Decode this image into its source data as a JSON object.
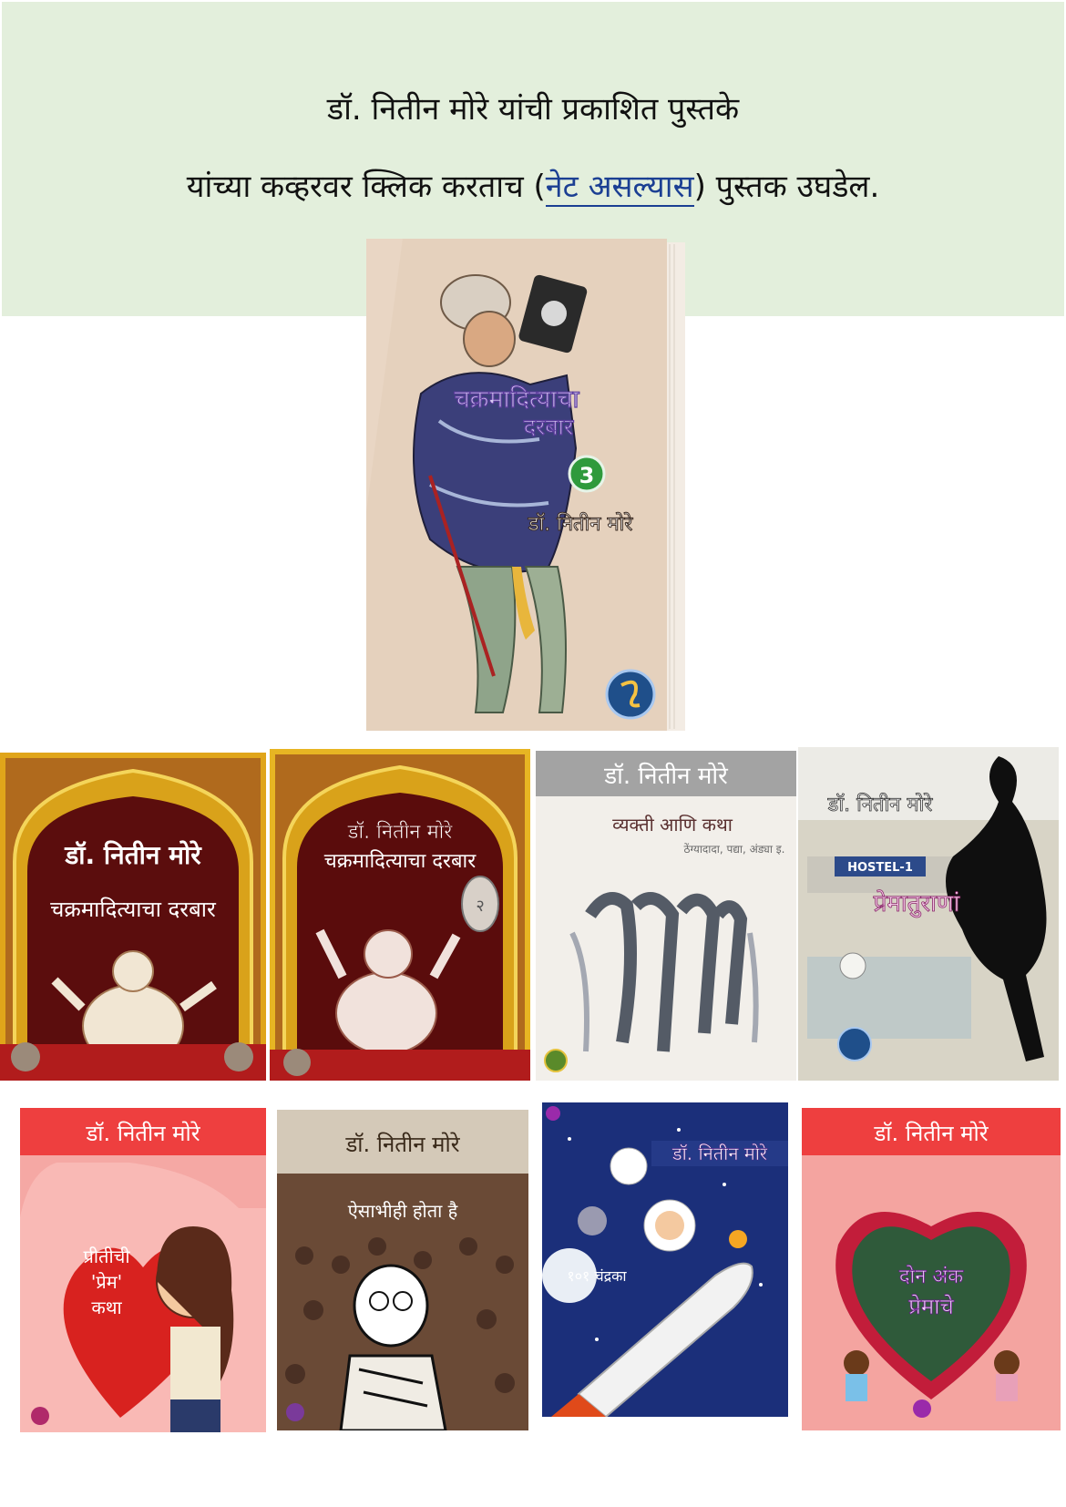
{
  "header": {
    "line1": "डॉ. नितीन मोरे यांची प्रकाशित पुस्तके",
    "line2_before": "यांच्या कव्हरवर क्लिक करताच (",
    "line2_link": "नेट असल्यास",
    "line2_after": ") पुस्तक उघडेल."
  },
  "featured": {
    "title_line1": "चक्रमादित्याचा",
    "title_line2": "दरबार",
    "volume": "3",
    "author": "डॉ. नितीन मोरे"
  },
  "row1": [
    {
      "author": "डॉ. नितीन मोरे",
      "title": "चक्रमादित्याचा दरबार"
    },
    {
      "author": "डॉ. नितीन मोरे",
      "title": "चक्रमादित्याचा दरबार",
      "volume": "२"
    },
    {
      "author": "डॉ. नितीन मोरे",
      "title": "व्यक्ती आणि कथा",
      "subtitle": "ठेंग्यादादा, पद्या, अंड्या इ."
    },
    {
      "author": "डॉ. नितीन मोरे",
      "title": "प्रेमातुराणां",
      "sign": "HOSTEL-1"
    }
  ],
  "row2": [
    {
      "author": "डॉ. नितीन मोरे",
      "title_line1": "प्रीतीची",
      "title_line2": "'प्रेम'",
      "title_line3": "कथा"
    },
    {
      "author": "डॉ. नितीन मोरे",
      "title": "ऐसाभीही होता है"
    },
    {
      "author": "डॉ. नितीन मोरे",
      "title": "१०१ चंद्रका"
    },
    {
      "author": "डॉ. नितीन मोरे",
      "title_line1": "दोन अंक",
      "title_line2": "प्रेमाचे"
    }
  ],
  "colors": {
    "banner": "#e3efdc",
    "link": "#1b3f93"
  }
}
